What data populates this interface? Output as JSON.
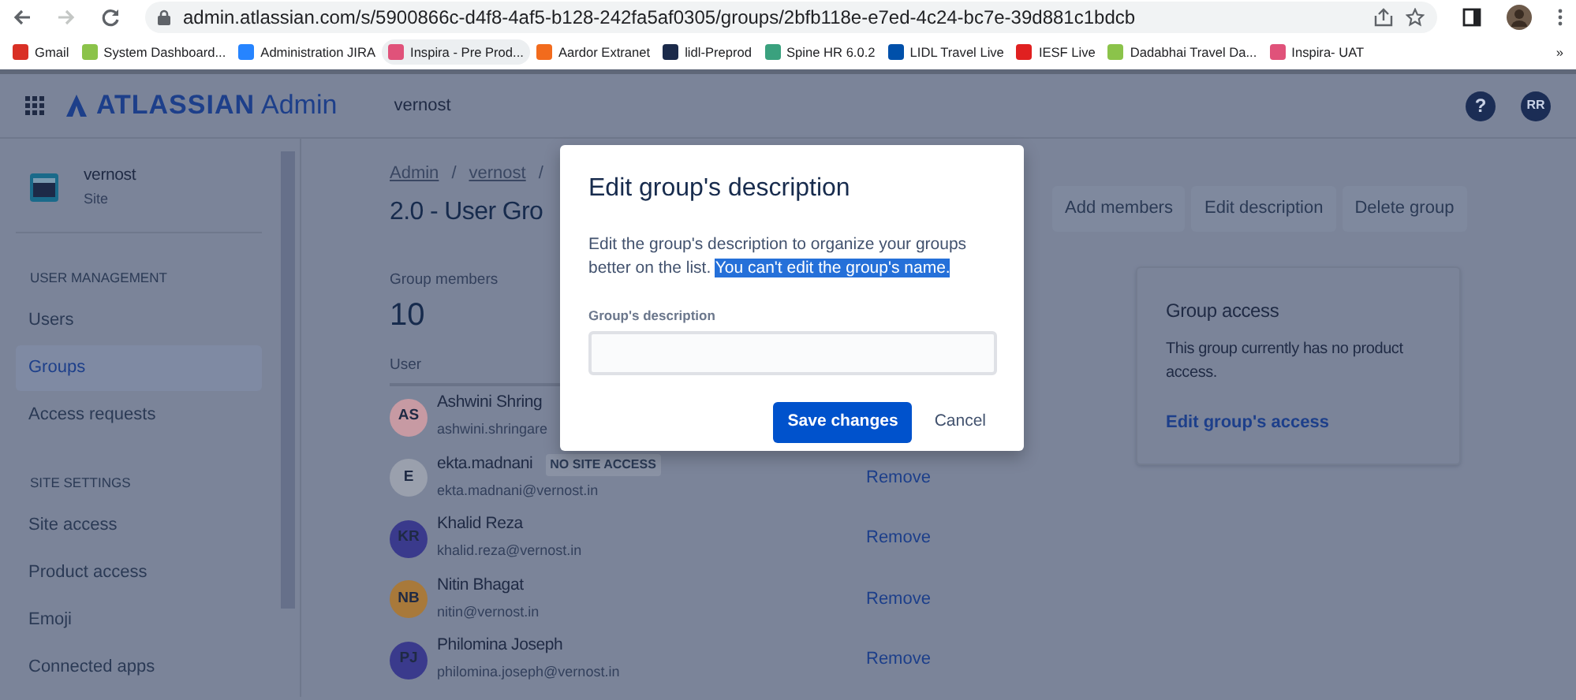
{
  "browser": {
    "url": "admin.atlassian.com/s/5900866c-d4f8-4af5-b128-242fa5af0305/groups/2bfb118e-e7ed-4c24-bc7e-39d881c1bdcb",
    "forward_disabled": true,
    "bookmarks": [
      {
        "label": "Gmail",
        "color": "#d93025",
        "selected": false
      },
      {
        "label": "System Dashboard...",
        "color": "#8bc34a",
        "selected": false
      },
      {
        "label": "Administration JIRA",
        "color": "#2684ff",
        "selected": false
      },
      {
        "label": "Inspira - Pre Prod...",
        "color": "#e0527a",
        "selected": true
      },
      {
        "label": "Aardor Extranet",
        "color": "#f26b1d",
        "selected": false
      },
      {
        "label": "lidl-Preprod",
        "color": "#1b2a4a",
        "selected": false
      },
      {
        "label": "Spine HR 6.0.2",
        "color": "#3aa17e",
        "selected": false
      },
      {
        "label": "LIDL Travel Live",
        "color": "#0050aa",
        "selected": false
      },
      {
        "label": "IESF Live",
        "color": "#e02020",
        "selected": false
      },
      {
        "label": "Dadabhai Travel Da...",
        "color": "#8bc34a",
        "selected": false
      },
      {
        "label": "Inspira- UAT",
        "color": "#e0527a",
        "selected": false
      }
    ],
    "more": "»"
  },
  "header": {
    "brand": "ATLASSIAN",
    "product": "Admin",
    "org": "vernost",
    "help": "?",
    "user_initials": "RR"
  },
  "sidebar": {
    "site": {
      "name": "vernost",
      "subtitle": "Site"
    },
    "sections": [
      {
        "heading": "USER MANAGEMENT",
        "items": [
          {
            "label": "Users",
            "selected": false
          },
          {
            "label": "Groups",
            "selected": true
          },
          {
            "label": "Access requests",
            "selected": false
          }
        ]
      },
      {
        "heading": "SITE SETTINGS",
        "items": [
          {
            "label": "Site access",
            "selected": false
          },
          {
            "label": "Product access",
            "selected": false
          },
          {
            "label": "Emoji",
            "selected": false
          },
          {
            "label": "Connected apps",
            "selected": false
          }
        ]
      }
    ]
  },
  "main": {
    "breadcrumb": [
      {
        "label": "Admin",
        "separator": "/"
      },
      {
        "label": "vernost",
        "separator": "/"
      }
    ],
    "title": "2.0 - User Gro",
    "members_label": "Group members",
    "members_count": "10",
    "column_user": "User",
    "actions": [
      "Add members",
      "Edit description",
      "Delete group"
    ],
    "members": [
      {
        "initials": "AS",
        "name": "Ashwini Shring",
        "email": "ashwini.shringare",
        "color": "#c79aa3"
      },
      {
        "initials": "E",
        "name": "ekta.madnani",
        "email": "ekta.madnani@vernost.in",
        "color": "#9aa0ad",
        "badge": "NO SITE ACCESS",
        "action": "Remove"
      },
      {
        "initials": "KR",
        "name": "Khalid Reza",
        "email": "khalid.reza@vernost.in",
        "color": "#3a3a8c",
        "action": "Remove"
      },
      {
        "initials": "NB",
        "name": "Nitin Bhagat",
        "email": "nitin@vernost.in",
        "color": "#a8793a",
        "action": "Remove"
      },
      {
        "initials": "PJ",
        "name": "Philomina Joseph",
        "email": "philomina.joseph@vernost.in",
        "color": "#3a3a8c",
        "action": "Remove"
      }
    ],
    "access_card": {
      "title": "Group access",
      "text": "This group currently has no product access.",
      "link": "Edit group's access"
    }
  },
  "dialog": {
    "title": "Edit group's description",
    "text": "Edit the group's description to organize your groups better on the list.",
    "highlighted": "You can't edit the group's name.",
    "field_label": "Group's description",
    "primary": "Save changes",
    "cancel": "Cancel"
  }
}
